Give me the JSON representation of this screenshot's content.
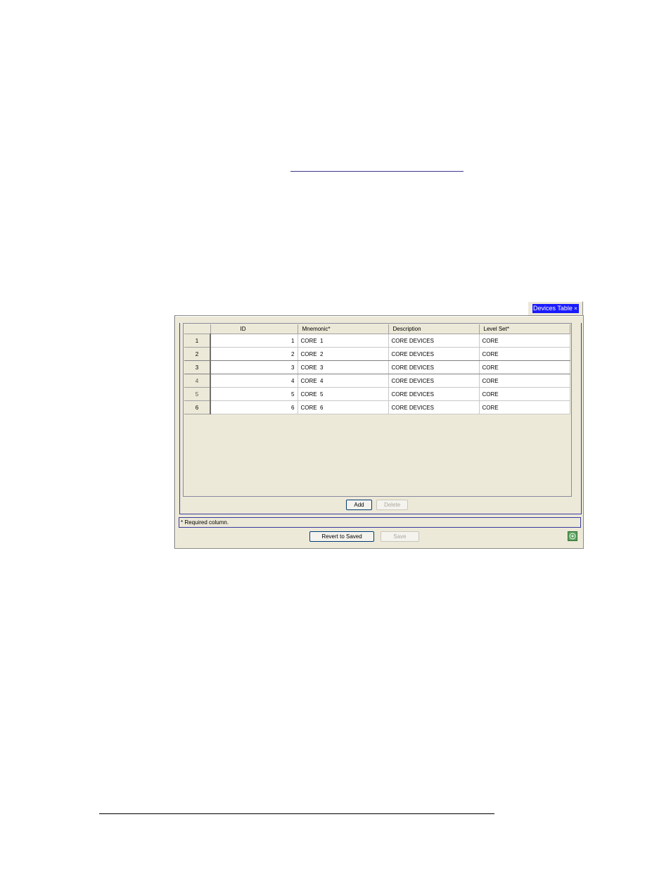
{
  "tab": {
    "label": "Devices Table",
    "close_glyph": "×"
  },
  "table": {
    "columns": [
      "",
      "ID",
      "Mnemonic*",
      "Description",
      "Level Set*"
    ],
    "rows": [
      {
        "row": "1",
        "id": "1",
        "mnemonic": "CORE  1",
        "description": "CORE DEVICES",
        "level_set": "CORE"
      },
      {
        "row": "2",
        "id": "2",
        "mnemonic": "CORE  2",
        "description": "CORE DEVICES",
        "level_set": "CORE"
      },
      {
        "row": "3",
        "id": "3",
        "mnemonic": "CORE  3",
        "description": "CORE DEVICES",
        "level_set": "CORE"
      },
      {
        "row": "4",
        "id": "4",
        "mnemonic": "CORE  4",
        "description": "CORE DEVICES",
        "level_set": "CORE"
      },
      {
        "row": "5",
        "id": "5",
        "mnemonic": "CORE  5",
        "description": "CORE DEVICES",
        "level_set": "CORE"
      },
      {
        "row": "6",
        "id": "6",
        "mnemonic": "CORE  6",
        "description": "CORE DEVICES",
        "level_set": "CORE"
      }
    ]
  },
  "buttons": {
    "add": "Add",
    "delete": "Delete",
    "revert": "Revert to Saved",
    "save": "Save"
  },
  "footer": {
    "required_note": "* Required column."
  },
  "icons": {
    "tab_close": "close-icon",
    "help": "help-icon"
  },
  "colors": {
    "tab_highlight": "#1a1aff",
    "panel_border": "#3a3aa0",
    "window_bg": "#ece9d8"
  }
}
